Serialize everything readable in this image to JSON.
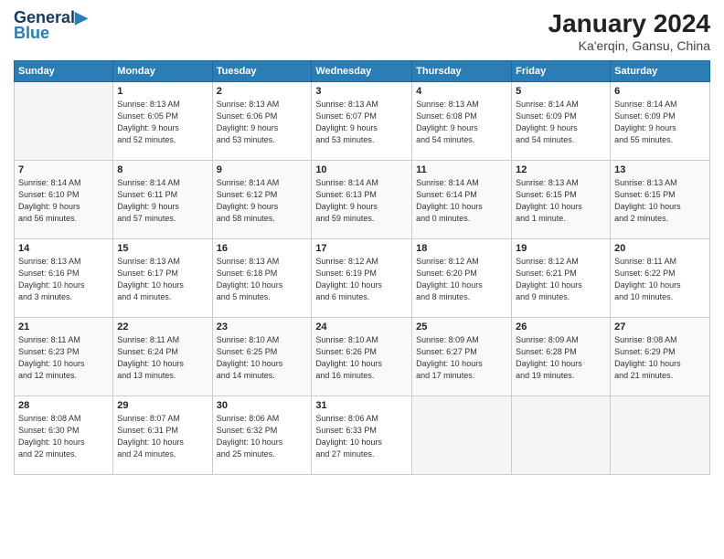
{
  "header": {
    "title": "January 2024",
    "subtitle": "Ka'erqin, Gansu, China"
  },
  "calendar": {
    "columns": [
      "Sunday",
      "Monday",
      "Tuesday",
      "Wednesday",
      "Thursday",
      "Friday",
      "Saturday"
    ],
    "weeks": [
      [
        {
          "day": "",
          "info": ""
        },
        {
          "day": "1",
          "info": "Sunrise: 8:13 AM\nSunset: 6:05 PM\nDaylight: 9 hours\nand 52 minutes."
        },
        {
          "day": "2",
          "info": "Sunrise: 8:13 AM\nSunset: 6:06 PM\nDaylight: 9 hours\nand 53 minutes."
        },
        {
          "day": "3",
          "info": "Sunrise: 8:13 AM\nSunset: 6:07 PM\nDaylight: 9 hours\nand 53 minutes."
        },
        {
          "day": "4",
          "info": "Sunrise: 8:13 AM\nSunset: 6:08 PM\nDaylight: 9 hours\nand 54 minutes."
        },
        {
          "day": "5",
          "info": "Sunrise: 8:14 AM\nSunset: 6:09 PM\nDaylight: 9 hours\nand 54 minutes."
        },
        {
          "day": "6",
          "info": "Sunrise: 8:14 AM\nSunset: 6:09 PM\nDaylight: 9 hours\nand 55 minutes."
        }
      ],
      [
        {
          "day": "7",
          "info": "Sunrise: 8:14 AM\nSunset: 6:10 PM\nDaylight: 9 hours\nand 56 minutes."
        },
        {
          "day": "8",
          "info": "Sunrise: 8:14 AM\nSunset: 6:11 PM\nDaylight: 9 hours\nand 57 minutes."
        },
        {
          "day": "9",
          "info": "Sunrise: 8:14 AM\nSunset: 6:12 PM\nDaylight: 9 hours\nand 58 minutes."
        },
        {
          "day": "10",
          "info": "Sunrise: 8:14 AM\nSunset: 6:13 PM\nDaylight: 9 hours\nand 59 minutes."
        },
        {
          "day": "11",
          "info": "Sunrise: 8:14 AM\nSunset: 6:14 PM\nDaylight: 10 hours\nand 0 minutes."
        },
        {
          "day": "12",
          "info": "Sunrise: 8:13 AM\nSunset: 6:15 PM\nDaylight: 10 hours\nand 1 minute."
        },
        {
          "day": "13",
          "info": "Sunrise: 8:13 AM\nSunset: 6:15 PM\nDaylight: 10 hours\nand 2 minutes."
        }
      ],
      [
        {
          "day": "14",
          "info": "Sunrise: 8:13 AM\nSunset: 6:16 PM\nDaylight: 10 hours\nand 3 minutes."
        },
        {
          "day": "15",
          "info": "Sunrise: 8:13 AM\nSunset: 6:17 PM\nDaylight: 10 hours\nand 4 minutes."
        },
        {
          "day": "16",
          "info": "Sunrise: 8:13 AM\nSunset: 6:18 PM\nDaylight: 10 hours\nand 5 minutes."
        },
        {
          "day": "17",
          "info": "Sunrise: 8:12 AM\nSunset: 6:19 PM\nDaylight: 10 hours\nand 6 minutes."
        },
        {
          "day": "18",
          "info": "Sunrise: 8:12 AM\nSunset: 6:20 PM\nDaylight: 10 hours\nand 8 minutes."
        },
        {
          "day": "19",
          "info": "Sunrise: 8:12 AM\nSunset: 6:21 PM\nDaylight: 10 hours\nand 9 minutes."
        },
        {
          "day": "20",
          "info": "Sunrise: 8:11 AM\nSunset: 6:22 PM\nDaylight: 10 hours\nand 10 minutes."
        }
      ],
      [
        {
          "day": "21",
          "info": "Sunrise: 8:11 AM\nSunset: 6:23 PM\nDaylight: 10 hours\nand 12 minutes."
        },
        {
          "day": "22",
          "info": "Sunrise: 8:11 AM\nSunset: 6:24 PM\nDaylight: 10 hours\nand 13 minutes."
        },
        {
          "day": "23",
          "info": "Sunrise: 8:10 AM\nSunset: 6:25 PM\nDaylight: 10 hours\nand 14 minutes."
        },
        {
          "day": "24",
          "info": "Sunrise: 8:10 AM\nSunset: 6:26 PM\nDaylight: 10 hours\nand 16 minutes."
        },
        {
          "day": "25",
          "info": "Sunrise: 8:09 AM\nSunset: 6:27 PM\nDaylight: 10 hours\nand 17 minutes."
        },
        {
          "day": "26",
          "info": "Sunrise: 8:09 AM\nSunset: 6:28 PM\nDaylight: 10 hours\nand 19 minutes."
        },
        {
          "day": "27",
          "info": "Sunrise: 8:08 AM\nSunset: 6:29 PM\nDaylight: 10 hours\nand 21 minutes."
        }
      ],
      [
        {
          "day": "28",
          "info": "Sunrise: 8:08 AM\nSunset: 6:30 PM\nDaylight: 10 hours\nand 22 minutes."
        },
        {
          "day": "29",
          "info": "Sunrise: 8:07 AM\nSunset: 6:31 PM\nDaylight: 10 hours\nand 24 minutes."
        },
        {
          "day": "30",
          "info": "Sunrise: 8:06 AM\nSunset: 6:32 PM\nDaylight: 10 hours\nand 25 minutes."
        },
        {
          "day": "31",
          "info": "Sunrise: 8:06 AM\nSunset: 6:33 PM\nDaylight: 10 hours\nand 27 minutes."
        },
        {
          "day": "",
          "info": ""
        },
        {
          "day": "",
          "info": ""
        },
        {
          "day": "",
          "info": ""
        }
      ]
    ]
  }
}
